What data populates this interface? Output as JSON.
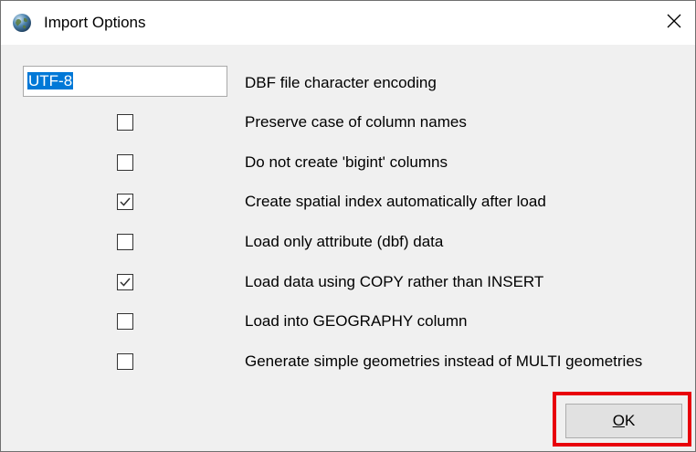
{
  "window": {
    "title": "Import Options",
    "app_icon": "globe-icon",
    "close_icon": "close-icon"
  },
  "encoding": {
    "value": "UTF-8",
    "label": "DBF file character encoding"
  },
  "options": [
    {
      "label": "Preserve case of column names",
      "checked": false
    },
    {
      "label": "Do not create 'bigint' columns",
      "checked": false
    },
    {
      "label": "Create spatial index automatically after load",
      "checked": true
    },
    {
      "label": "Load only attribute (dbf) data",
      "checked": false
    },
    {
      "label": "Load data using COPY rather than INSERT",
      "checked": true
    },
    {
      "label": "Load into GEOGRAPHY column",
      "checked": false
    },
    {
      "label": "Generate simple geometries instead of MULTI geometries",
      "checked": false
    }
  ],
  "buttons": {
    "ok_label_mnemonic": "O",
    "ok_label_rest": "K"
  },
  "colors": {
    "highlight": "#e8000b",
    "selection": "#0078d7"
  }
}
